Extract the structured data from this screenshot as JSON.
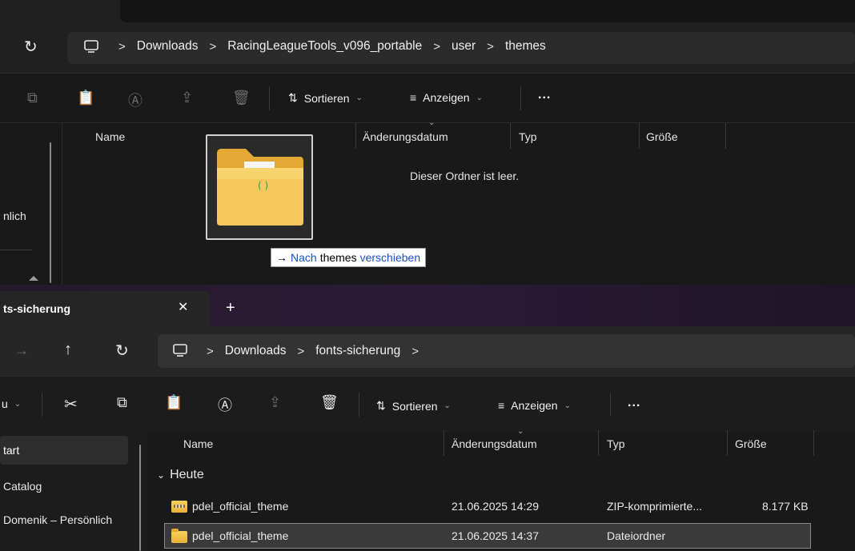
{
  "top_window": {
    "breadcrumb": [
      "Downloads",
      "RacingLeagueTools_v096_portable",
      "user",
      "themes"
    ],
    "toolbar": {
      "sort_label": "Sortieren",
      "view_label": "Anzeigen",
      "more_label": "..."
    },
    "columns": {
      "name": "Name",
      "date": "Änderungsdatum",
      "type": "Typ",
      "size": "Größe"
    },
    "empty_text": "Dieser Ordner ist leer.",
    "sidebar_partial": "nlich",
    "drag_tooltip": {
      "arrow": "→",
      "prefix": "Nach",
      "target": "themes",
      "suffix": "verschieben"
    }
  },
  "bottom_window": {
    "tab_title": "ts-sicherung",
    "tab_close": "✕",
    "tab_add": "+",
    "breadcrumb": [
      "Downloads",
      "fonts-sicherung"
    ],
    "toolbar": {
      "new_partial": "u",
      "sort_label": "Sortieren",
      "view_label": "Anzeigen",
      "more_label": "..."
    },
    "columns": {
      "name": "Name",
      "date": "Änderungsdatum",
      "type": "Typ",
      "size": "Größe"
    },
    "group_header": "Heute",
    "sidebar": [
      "tart",
      "Catalog",
      "Domenik – Persönlich"
    ],
    "files": [
      {
        "name": "pdel_official_theme",
        "date": "21.06.2025 14:29",
        "type": "ZIP-komprimierte...",
        "size": "8.177 KB",
        "icon": "zip-folder-icon"
      },
      {
        "name": "pdel_official_theme",
        "date": "21.06.2025 14:37",
        "type": "Dateiordner",
        "size": "",
        "icon": "folder-icon"
      }
    ]
  },
  "colors": {
    "accent": "#4aa3ff",
    "folder": "#f2c14e",
    "background": "#191919"
  }
}
